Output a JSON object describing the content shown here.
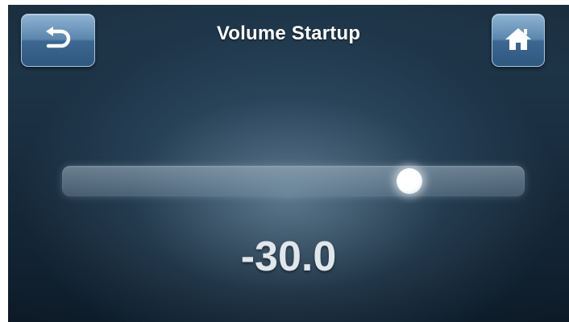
{
  "screen": {
    "title": "Volume Startup"
  },
  "navigation": {
    "back_icon": "back-arrow-icon",
    "home_icon": "home-icon"
  },
  "slider": {
    "value_text": "-30.0",
    "position_fraction": 0.75
  },
  "colors": {
    "button_accent": "#4a78a2",
    "background": "#1a2f42",
    "value_text": "#dfe6ec"
  }
}
